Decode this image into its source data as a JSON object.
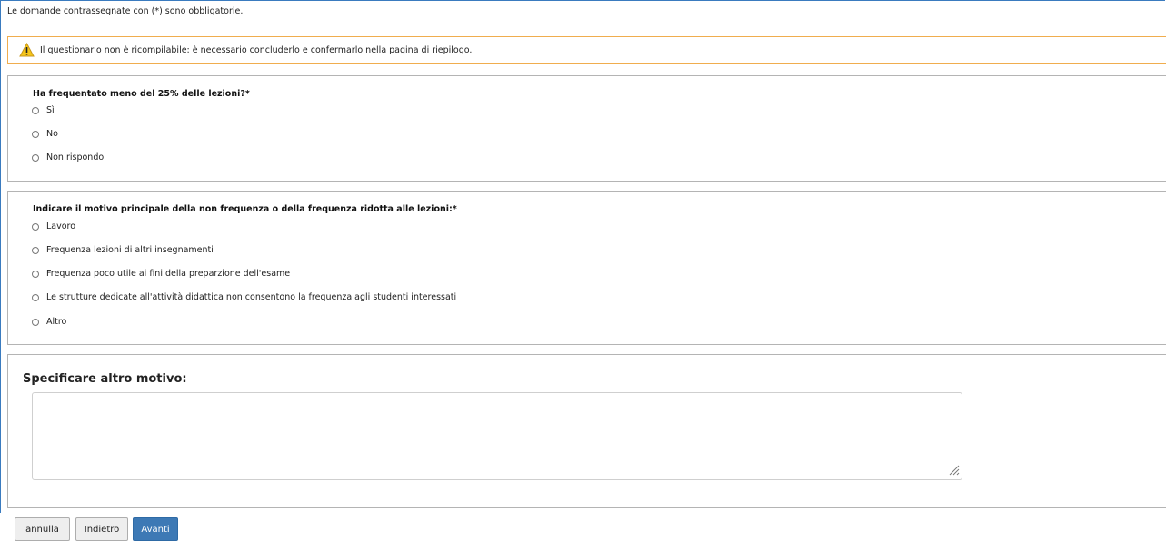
{
  "intro_text": "Le domande contrassegnate con (*) sono obbligatorie.",
  "warning": {
    "icon": "warning-icon",
    "text": "Il questionario non è ricompilabile: è necessario concluderlo e confermarlo nella pagina di riepilogo.",
    "border_color": "#f0ad4e"
  },
  "question1": {
    "title": "Ha frequentato meno del 25% delle lezioni?*",
    "options": [
      "Sì",
      "No",
      "Non rispondo"
    ]
  },
  "question2": {
    "title": "Indicare il motivo principale della non frequenza o della frequenza ridotta alle lezioni:*",
    "options": [
      "Lavoro",
      "Frequenza lezioni di altri insegnamenti",
      "Frequenza poco utile ai fini della preparzione dell'esame",
      "Le strutture dedicate all'attività didattica non consentono la frequenza agli studenti interessati",
      "Altro"
    ]
  },
  "question3": {
    "title": "Specificare altro motivo:",
    "value": ""
  },
  "buttons": {
    "cancel": "annulla",
    "back": "Indietro",
    "next": "Avanti"
  },
  "colors": {
    "accent": "#3d79b5",
    "frame": "#3a7bbf"
  }
}
